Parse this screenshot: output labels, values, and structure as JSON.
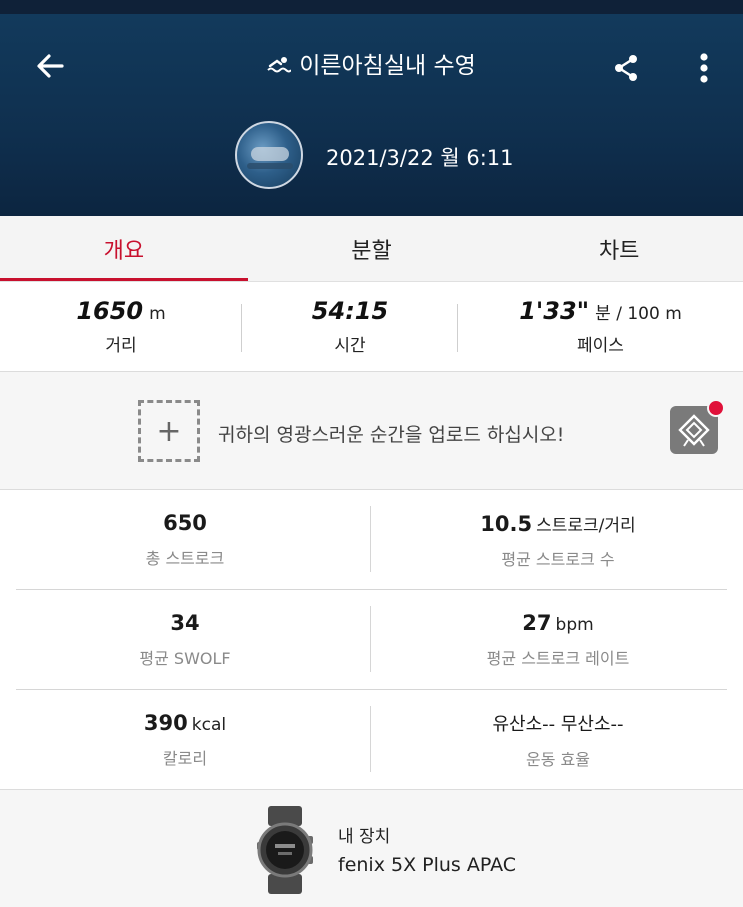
{
  "header": {
    "title": "이른아침실내 수영",
    "datetime": "2021/3/22 월 6:11"
  },
  "tabs": [
    {
      "label": "개요",
      "active": true
    },
    {
      "label": "분할",
      "active": false
    },
    {
      "label": "차트",
      "active": false
    }
  ],
  "summary": {
    "distance": {
      "value": "1650",
      "unit": "m",
      "label": "거리"
    },
    "time": {
      "value": "54:15",
      "label": "시간"
    },
    "pace": {
      "value": "1'33\"",
      "unit": "분 / 100 m",
      "label": "페이스"
    }
  },
  "upload": {
    "text": "귀하의 영광스러운 순간을 업로드 하십시오!"
  },
  "stats": {
    "total_strokes": {
      "value": "650",
      "unit": "",
      "label": "총 스트로크"
    },
    "avg_strokes": {
      "value": "10.5",
      "unit": "스트로크/거리",
      "label": "평균 스트로크 수"
    },
    "avg_swolf": {
      "value": "34",
      "unit": "",
      "label": "평균 SWOLF"
    },
    "avg_stroke_rate": {
      "value": "27",
      "unit": "bpm",
      "label": "평균 스트로크 레이트"
    },
    "calories": {
      "value": "390",
      "unit": "kcal",
      "label": "칼로리"
    },
    "efficiency": {
      "value": "유산소-- 무산소--",
      "unit": "",
      "label": "운동 효율"
    }
  },
  "device": {
    "label": "내 장치",
    "name": "fenix 5X Plus APAC"
  },
  "colors": {
    "accent": "#c8102e",
    "header_bg": "#123a5c",
    "notification_dot": "#e0113a"
  },
  "icons": [
    "back-arrow-icon",
    "swim-icon",
    "share-icon",
    "more-vertical-icon",
    "plus-icon",
    "badge-icon",
    "watch-icon"
  ]
}
